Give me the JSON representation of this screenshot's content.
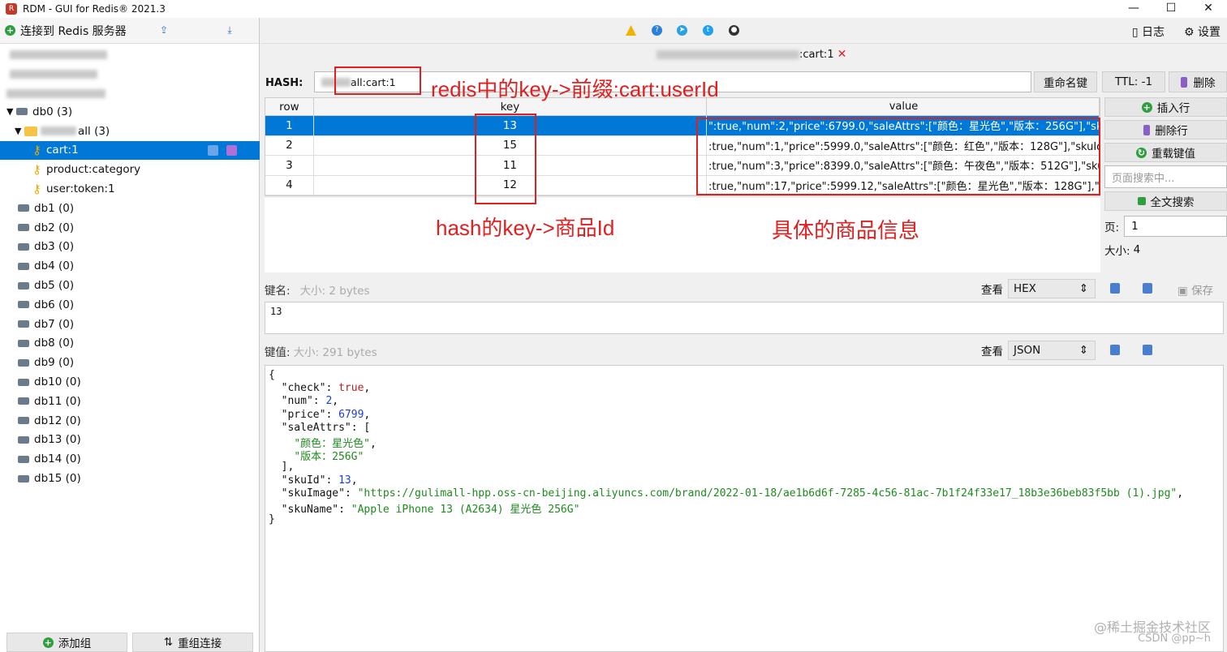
{
  "window": {
    "title": "RDM - GUI for Redis® 2021.3",
    "minimize": "—",
    "maximize": "☐",
    "close": "✕"
  },
  "sidebar": {
    "connect_label": "连接到 Redis 服务器",
    "db0_label": "db0",
    "db0_count": "(3)",
    "folder_label": "all (3)",
    "keys": [
      "cart:1",
      "product:category",
      "user:token:1"
    ],
    "dbs": [
      {
        "name": "db1",
        "count": "(0)"
      },
      {
        "name": "db2",
        "count": "(0)"
      },
      {
        "name": "db3",
        "count": "(0)"
      },
      {
        "name": "db4",
        "count": "(0)"
      },
      {
        "name": "db5",
        "count": "(0)"
      },
      {
        "name": "db6",
        "count": "(0)"
      },
      {
        "name": "db7",
        "count": "(0)"
      },
      {
        "name": "db8",
        "count": "(0)"
      },
      {
        "name": "db9",
        "count": "(0)"
      },
      {
        "name": "db10",
        "count": "(0)"
      },
      {
        "name": "db11",
        "count": "(0)"
      },
      {
        "name": "db12",
        "count": "(0)"
      },
      {
        "name": "db13",
        "count": "(0)"
      },
      {
        "name": "db14",
        "count": "(0)"
      },
      {
        "name": "db15",
        "count": "(0)"
      }
    ],
    "add_group": "添加组",
    "reconnect": "重组连接"
  },
  "toolbar": {
    "log": "日志",
    "settings": "设置"
  },
  "tab": {
    "label": ":cart:1",
    "close": "✕"
  },
  "hash": {
    "type_label": "HASH:",
    "key_name": "all:cart:1",
    "rename": "重命名键",
    "ttl": "TTL:  -1",
    "delete": "删除"
  },
  "table": {
    "headers": {
      "row": "row",
      "key": "key",
      "value": "value"
    },
    "rows": [
      {
        "row": "1",
        "key": "13",
        "value": "\":true,\"num\":2,\"price\":6799.0,\"saleAttrs\":[\"颜色：星光色\",\"版本：256G\"],\"skuI"
      },
      {
        "row": "2",
        "key": "15",
        "value": ":true,\"num\":1,\"price\":5999.0,\"saleAttrs\":[\"颜色：红色\",\"版本：128G\"],\"skuId\":"
      },
      {
        "row": "3",
        "key": "11",
        "value": ":true,\"num\":3,\"price\":8399.0,\"saleAttrs\":[\"颜色：午夜色\",\"版本：512G\"],\"skuI"
      },
      {
        "row": "4",
        "key": "12",
        "value": ":true,\"num\":17,\"price\":5999.12,\"saleAttrs\":[\"颜色：星光色\",\"版本：128G\"],\"sk"
      }
    ]
  },
  "side_panel": {
    "insert_row": "插入行",
    "delete_row": "删除行",
    "reload": "重载键值",
    "search_placeholder": "页面搜索中...",
    "full_search": "全文搜索",
    "page_label": "页:",
    "page_value": "1",
    "size_label": "大小:",
    "size_value": "4"
  },
  "key_section": {
    "label": "键名:",
    "hint": "大小: 2 bytes",
    "view_label": "查看",
    "view_value": "HEX",
    "save": "保存",
    "content": "13"
  },
  "value_section": {
    "label": "键值:",
    "hint": "大小: 291 bytes",
    "view_label": "查看",
    "view_value": "JSON"
  },
  "json": {
    "open": "{",
    "check_key": "\"check\"",
    "check_val": "true",
    "num_key": "\"num\"",
    "num_val": "2",
    "price_key": "\"price\"",
    "price_val": "6799",
    "saleAttrs_key": "\"saleAttrs\"",
    "attr1": "\"颜色：星光色\"",
    "attr2": "\"版本：256G\"",
    "skuId_key": "\"skuId\"",
    "skuId_val": "13",
    "skuImage_key": "\"skuImage\"",
    "skuImage_val": "\"https://gulimall-hpp.oss-cn-beijing.aliyuncs.com/brand/2022-01-18/ae1b6d6f-7285-4c56-81ac-7b1f24f33e17_18b3e36beb83f5bb (1).jpg\"",
    "skuName_key": "\"skuName\"",
    "skuName_val": "\"Apple iPhone 13 (A2634) 星光色 256G\"",
    "close": "}"
  },
  "annotations": {
    "redis_key": "redis中的key->前缀:cart:userId",
    "hash_key": "hash的key->商品Id",
    "product_info": "具体的商品信息"
  },
  "watermark": {
    "line1": "@稀土掘金技术社区",
    "line2": "CSDN @pp~h"
  }
}
